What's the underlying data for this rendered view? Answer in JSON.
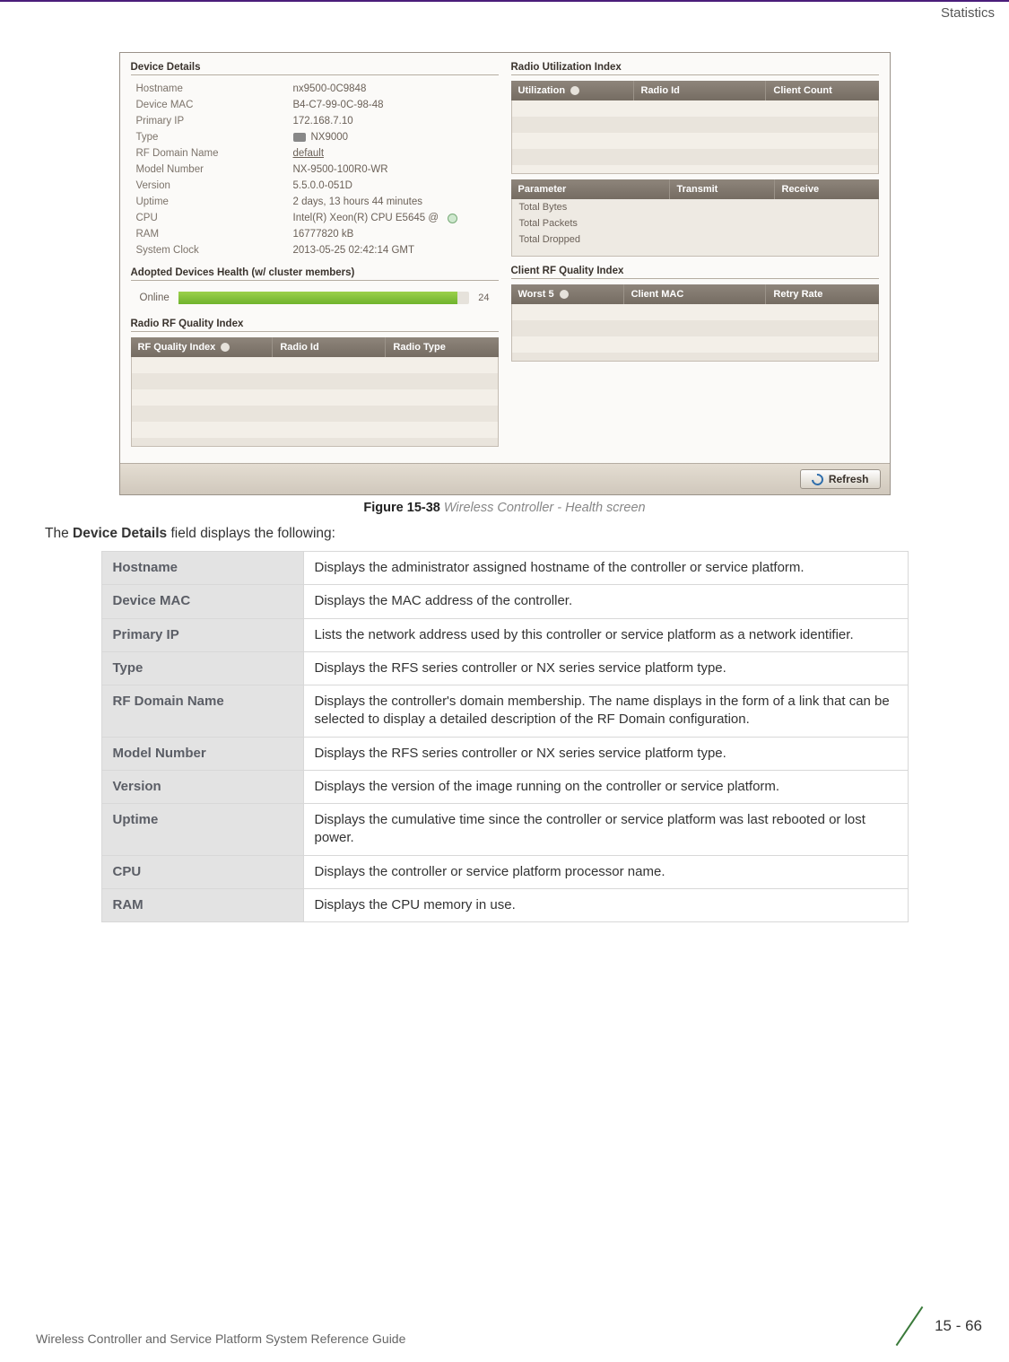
{
  "header": {
    "section": "Statistics"
  },
  "screenshot": {
    "device_details": {
      "legend": "Device Details",
      "rows": [
        {
          "label": "Hostname",
          "value": "nx9500-0C9848"
        },
        {
          "label": "Device MAC",
          "value": "B4-C7-99-0C-98-48"
        },
        {
          "label": "Primary IP",
          "value": "172.168.7.10"
        },
        {
          "label": "Type",
          "value": "NX9000",
          "icon": true
        },
        {
          "label": "RF Domain Name",
          "value": "default",
          "link": true
        },
        {
          "label": "Model Number",
          "value": "NX-9500-100R0-WR"
        },
        {
          "label": "Version",
          "value": "5.5.0.0-051D"
        },
        {
          "label": "Uptime",
          "value": "2 days, 13 hours 44 minutes"
        },
        {
          "label": "CPU",
          "value": "Intel(R) Xeon(R) CPU         E5645  @",
          "dot": true
        },
        {
          "label": "RAM",
          "value": "16777820 kB"
        },
        {
          "label": "System Clock",
          "value": "2013-05-25 02:42:14 GMT"
        }
      ]
    },
    "adopted": {
      "legend": "Adopted Devices Health (w/ cluster members)",
      "bar_label": "Online",
      "bar_value": "24"
    },
    "radio_rf": {
      "legend": "Radio RF Quality Index",
      "cols": {
        "c1": "RF Quality Index",
        "c2": "Radio Id",
        "c3": "Radio Type"
      }
    },
    "radio_util": {
      "legend": "Radio Utilization Index",
      "cols": {
        "c1": "Utilization",
        "c2": "Radio Id",
        "c3": "Client Count"
      },
      "param_cols": {
        "c1": "Parameter",
        "c2": "Transmit",
        "c3": "Receive"
      },
      "param_rows": [
        "Total Bytes",
        "Total Packets",
        "Total Dropped"
      ]
    },
    "client_rf": {
      "legend": "Client RF Quality Index",
      "cols": {
        "c1": "Worst 5",
        "c2": "Client MAC",
        "c3": "Retry Rate"
      }
    },
    "refresh": "Refresh"
  },
  "caption": {
    "label": "Figure 15-38",
    "title": "Wireless Controller - Health screen"
  },
  "intro": {
    "prefix": "The ",
    "bold": "Device Details",
    "suffix": " field displays the following:"
  },
  "table": [
    {
      "term": "Hostname",
      "desc": "Displays the administrator assigned hostname of the controller or service platform."
    },
    {
      "term": "Device MAC",
      "desc": "Displays the MAC address of the controller."
    },
    {
      "term": "Primary IP",
      "desc": "Lists the network address used by this controller or service platform as a network identifier."
    },
    {
      "term": "Type",
      "desc": "Displays the RFS series controller or NX series service platform type."
    },
    {
      "term": "RF Domain Name",
      "desc": "Displays the controller's domain membership. The name displays in the form of a link that can be selected to display a detailed description of the RF Domain configuration."
    },
    {
      "term": "Model Number",
      "desc": "Displays the RFS series controller or NX series service platform type."
    },
    {
      "term": "Version",
      "desc": "Displays the version of the image running on the controller or service platform."
    },
    {
      "term": "Uptime",
      "desc": "Displays the cumulative time since the controller or service platform was last rebooted or lost power."
    },
    {
      "term": "CPU",
      "desc": "Displays the controller or service platform processor name."
    },
    {
      "term": "RAM",
      "desc": "Displays the CPU memory in use."
    }
  ],
  "footer": {
    "left": "Wireless Controller and Service Platform System Reference Guide",
    "page": "15 - 66"
  }
}
